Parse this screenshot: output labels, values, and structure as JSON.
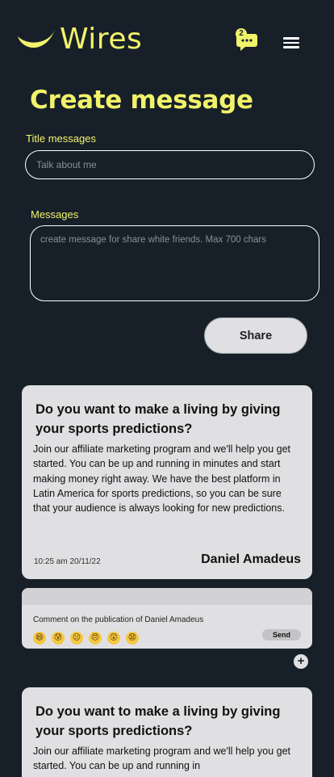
{
  "header": {
    "logo_text": "Wires",
    "chat_badge_count": "2",
    "icons": [
      "smile-logo-icon",
      "chat-bubble-icon",
      "hamburger-menu-icon"
    ]
  },
  "form": {
    "title": "Create message",
    "title_label": "Title messages",
    "title_placeholder": "Talk about me",
    "message_label": "Messages",
    "message_placeholder": "create message for share white friends. Max 700 chars",
    "share_label": "Share"
  },
  "posts": [
    {
      "title": "Do you want to make a living by giving your sports predictions?",
      "body": "Join our affiliate marketing program and we'll help you get started. You can be up and running in minutes and start making money right away. We have the best platform in Latin America for sports predictions, so you can be sure that your audience is always looking for new predictions.",
      "time": "10:25 am 20/11/22",
      "author": "Daniel Amadeus"
    },
    {
      "title": "Do you want to make a living by giving your sports predictions?",
      "body": "Join our affiliate marketing program and we'll help you get started. You can be up and running in"
    }
  ],
  "comment": {
    "label": "Comment on the publication of Daniel Amadeus",
    "send_label": "Send",
    "emojis": [
      "😄",
      "😰",
      "😕",
      "😠",
      "😲",
      "😧"
    ],
    "add_label": "+"
  },
  "colors": {
    "background": "#172029",
    "accent": "#f2f26b",
    "card": "#e0e0e2"
  }
}
